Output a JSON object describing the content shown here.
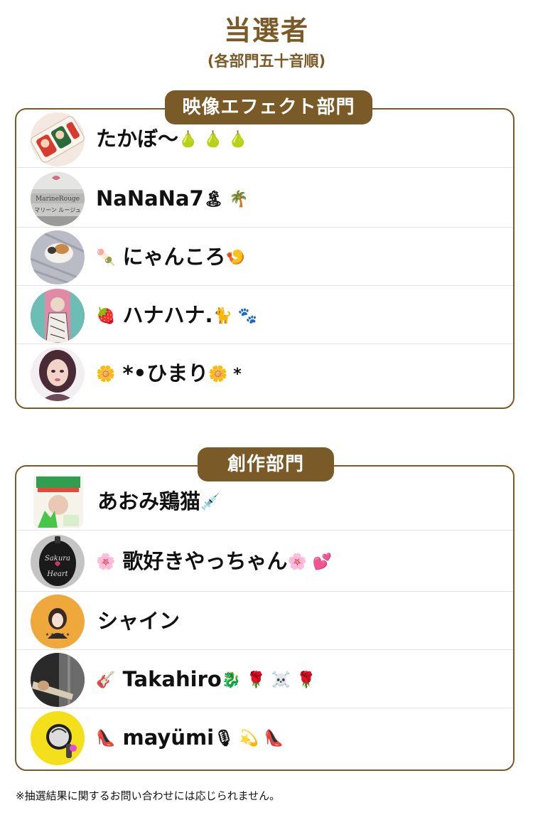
{
  "header": {
    "title": "当選者",
    "subtitle": "(各部門五十音順)"
  },
  "sections": [
    {
      "label": "映像エフェクト部門",
      "winners": [
        {
          "prefix": "",
          "name": "たかぼ〜",
          "suffix": "🍐 🍐 🍐"
        },
        {
          "prefix": "",
          "name": "NaNaNa7",
          "suffix": "🏝 🌴"
        },
        {
          "prefix": "🍡",
          "name": "にゃんころ",
          "suffix": "🍤"
        },
        {
          "prefix": "🍓",
          "name": "ハナハナ.",
          "suffix": "🐈 🐾"
        },
        {
          "prefix": "🌼",
          "name": "*•ひまり",
          "suffix": "🌼 *"
        }
      ]
    },
    {
      "label": "創作部門",
      "winners": [
        {
          "prefix": "",
          "name": "あおみ鶏猫",
          "suffix": "💉"
        },
        {
          "prefix": "🌸",
          "name": "歌好きやっちゃん",
          "suffix": "🌸 💕"
        },
        {
          "prefix": "",
          "name": "シャイン",
          "suffix": ""
        },
        {
          "prefix": "🎸",
          "name": "Takahiro",
          "suffix": "🐉 🌹 ☠️ 🌹"
        },
        {
          "prefix": "👠",
          "name": "mayümi",
          "suffix": "🎙 💫 👠"
        }
      ]
    }
  ],
  "footnote": "※抽選結果に関するお問い合わせには応じられません。",
  "colors": {
    "accent": "#7a5a26",
    "divider": "#e2e2e2"
  }
}
